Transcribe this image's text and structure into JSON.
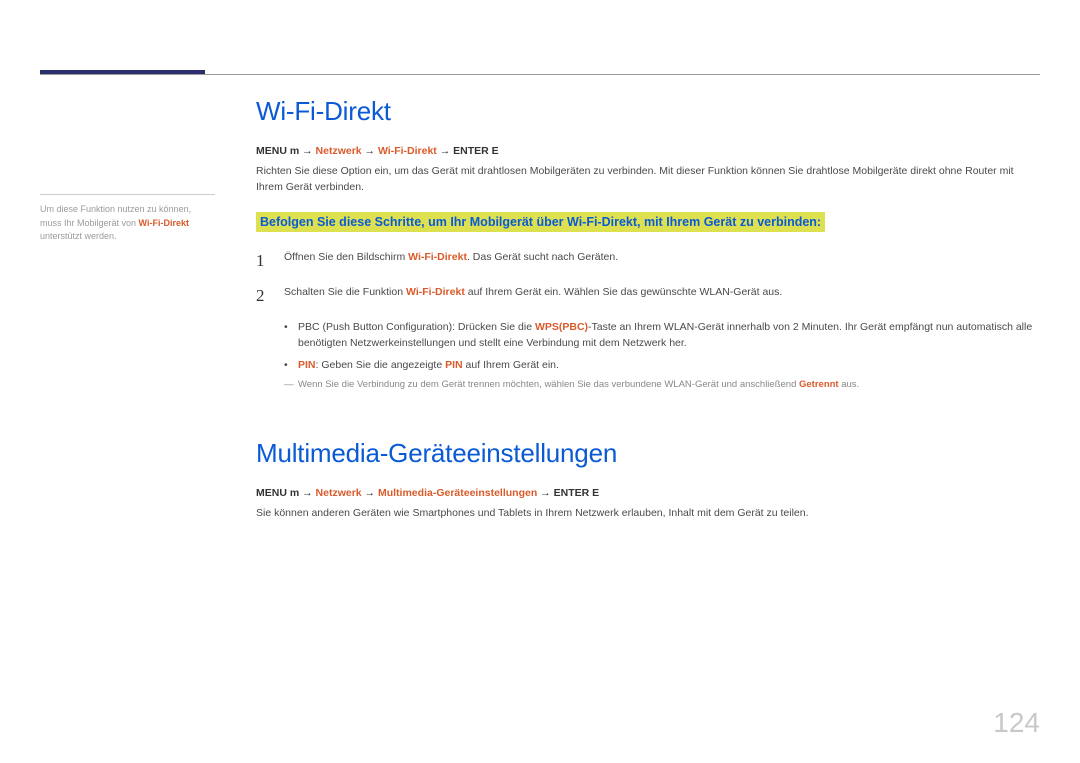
{
  "side_note": {
    "pre": "Um diese Funktion nutzen zu können, muss Ihr Mobilgerät von ",
    "em": "Wi-Fi-Direkt",
    "post": " unterstützt werden."
  },
  "section1": {
    "title": "Wi-Fi-Direkt",
    "menu_prefix": "MENU ",
    "menu_glyph1": "m",
    "menu_arrow": " → ",
    "menu_item1": "Netzwerk",
    "menu_item2": "Wi-Fi-Direkt",
    "menu_enter": "ENTER ",
    "menu_glyph2": "E",
    "intro": "Richten Sie diese Option ein, um das Gerät mit drahtlosen Mobilgeräten zu verbinden. Mit dieser Funktion können Sie drahtlose Mobilgeräte direkt ohne Router mit Ihrem Gerät verbinden.",
    "highlight": "Befolgen Sie diese Schritte, um Ihr Mobilgerät über Wi-Fi-Direkt, mit Ihrem Gerät zu verbinden:",
    "step1_pre": "Öffnen Sie den Bildschirm ",
    "step1_em": "Wi-Fi-Direkt",
    "step1_post": ". Das Gerät sucht nach Geräten.",
    "step2_pre": "Schalten Sie die Funktion ",
    "step2_em": "Wi-Fi-Direkt",
    "step2_post": " auf Ihrem Gerät ein. Wählen Sie das gewünschte WLAN-Gerät aus.",
    "bullet1_pre": "PBC (Push Button Configuration): Drücken Sie die ",
    "bullet1_em": "WPS(PBC)",
    "bullet1_post": "-Taste an Ihrem WLAN-Gerät innerhalb von 2 Minuten. Ihr Gerät empfängt nun automatisch alle benötigten Netzwerkeinstellungen und stellt eine Verbindung mit dem Netzwerk her.",
    "bullet2_em1": "PIN",
    "bullet2_mid": ": Geben Sie die angezeigte ",
    "bullet2_em2": "PIN",
    "bullet2_post": " auf Ihrem Gerät ein.",
    "footnote_pre": "Wenn Sie die Verbindung zu dem Gerät trennen möchten, wählen Sie das verbundene WLAN-Gerät und anschließend ",
    "footnote_em": "Getrennt",
    "footnote_post": " aus."
  },
  "section2": {
    "title": "Multimedia-Geräteeinstellungen",
    "menu_prefix": "MENU ",
    "menu_glyph1": "m",
    "menu_arrow": " → ",
    "menu_item1": "Netzwerk",
    "menu_item2": "Multimedia-Geräteeinstellungen",
    "menu_enter": "ENTER ",
    "menu_glyph2": "E",
    "body": "Sie können anderen Geräten wie Smartphones und Tablets in Ihrem Netzwerk erlauben, Inhalt mit dem Gerät zu teilen."
  },
  "page_number": "124",
  "numbers": {
    "one": "1",
    "two": "2"
  }
}
